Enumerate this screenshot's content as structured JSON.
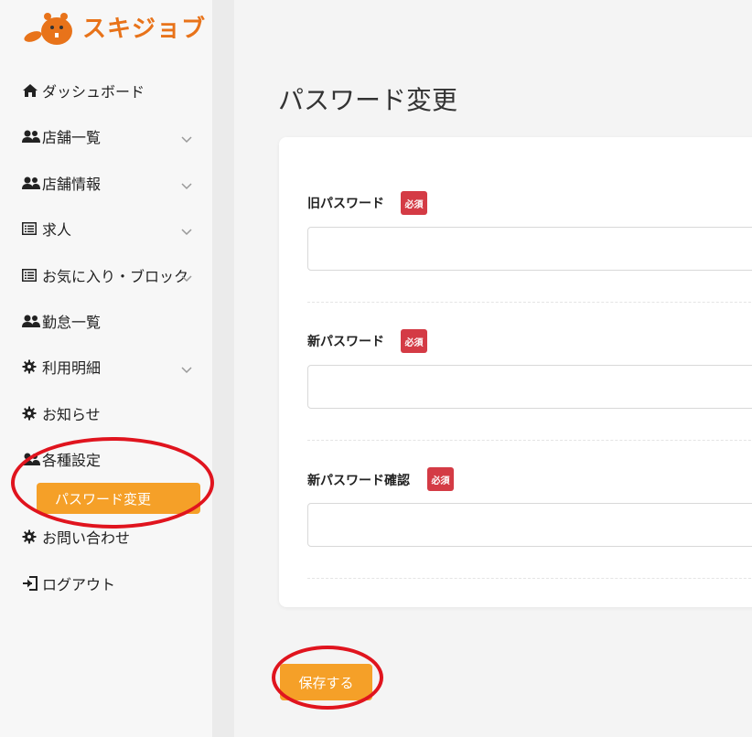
{
  "brand": {
    "name": "スキジョブ",
    "color": "#e8731a"
  },
  "colors": {
    "accent": "#f5a028",
    "required_badge": "#d43b45",
    "annotation": "#e0141e"
  },
  "sidebar": {
    "items": [
      {
        "label": "ダッシュボード",
        "icon": "home-icon",
        "expandable": false
      },
      {
        "label": "店舗一覧",
        "icon": "users-icon",
        "expandable": true
      },
      {
        "label": "店舗情報",
        "icon": "users-icon",
        "expandable": true
      },
      {
        "label": "求人",
        "icon": "list-icon",
        "expandable": true
      },
      {
        "label": "お気に入り・ブロック",
        "icon": "list-icon",
        "expandable": true
      },
      {
        "label": "勤怠一覧",
        "icon": "users-icon",
        "expandable": false
      },
      {
        "label": "利用明細",
        "icon": "gear-icon",
        "expandable": true
      },
      {
        "label": "お知らせ",
        "icon": "gear-icon",
        "expandable": false
      },
      {
        "label": "各種設定",
        "icon": "users-icon",
        "expandable": false
      },
      {
        "label": "お問い合わせ",
        "icon": "gear-icon",
        "expandable": false
      },
      {
        "label": "ログアウト",
        "icon": "logout-icon",
        "expandable": false
      }
    ],
    "active_sub_item": "パスワード変更"
  },
  "main": {
    "title": "パスワード変更",
    "required_label": "必須",
    "fields": [
      {
        "label": "旧パスワード",
        "value": ""
      },
      {
        "label": "新パスワード",
        "value": ""
      },
      {
        "label": "新パスワード確認",
        "value": ""
      }
    ],
    "save_label": "保存する"
  }
}
